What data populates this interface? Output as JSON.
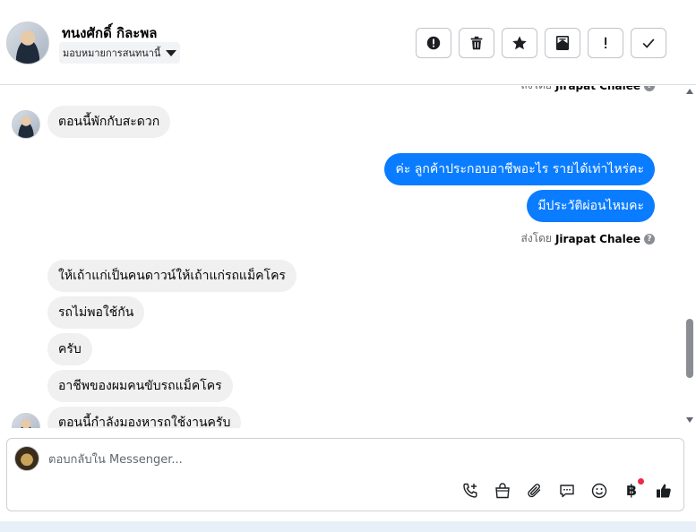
{
  "header": {
    "contact_name": "ทนงศักดิ์ กิละพล",
    "assign_label": "มอบหมายการสนทนานี้",
    "toolbar": [
      {
        "name": "spam-button",
        "icon": "alert-circle-icon"
      },
      {
        "name": "delete-button",
        "icon": "trash-icon"
      },
      {
        "name": "star-button",
        "icon": "star-icon"
      },
      {
        "name": "archive-button",
        "icon": "mail-archive-icon"
      },
      {
        "name": "follow-up-button",
        "icon": "exclamation-icon"
      },
      {
        "name": "mark-done-button",
        "icon": "check-icon"
      }
    ]
  },
  "chat": {
    "sent_by_prefix": "ส่งโดย",
    "agent_name": "Jirapat Chalee",
    "messages": [
      {
        "side": "in",
        "text": "ตอนนี้พักกับสะดวก"
      },
      {
        "side": "out",
        "text": "ค่ะ ลูกค้าประกอบอาชีพอะไร รายได้เท่าไหร่คะ"
      },
      {
        "side": "out",
        "text": "มีประวัติผ่อนไหมคะ"
      },
      {
        "side": "in",
        "text": "ให้เถ้าแก่เป็นคนดาวน์ให้เถ้าแก่รถแม็คโคร"
      },
      {
        "side": "in",
        "text": "รถไม่พอใช้กัน"
      },
      {
        "side": "in",
        "text": "ครับ"
      },
      {
        "side": "in",
        "text": "อาชีพของผมคนขับรถแม็คโคร"
      },
      {
        "side": "in",
        "text": "ตอนนี้กำลังมองหารถใช้งานครับ"
      }
    ]
  },
  "composer": {
    "placeholder": "ตอบกลับใน Messenger...",
    "tools": [
      {
        "name": "call-icon"
      },
      {
        "name": "shopping-bag-icon"
      },
      {
        "name": "attachment-icon"
      },
      {
        "name": "saved-reply-icon"
      },
      {
        "name": "emoji-icon"
      },
      {
        "name": "baht-payment-icon",
        "glyph": "฿"
      },
      {
        "name": "thumbs-up-icon"
      }
    ]
  },
  "colors": {
    "accent": "#0a7cff",
    "incoming_bubble": "#f0f0f0",
    "notification_dot": "#f02849"
  }
}
